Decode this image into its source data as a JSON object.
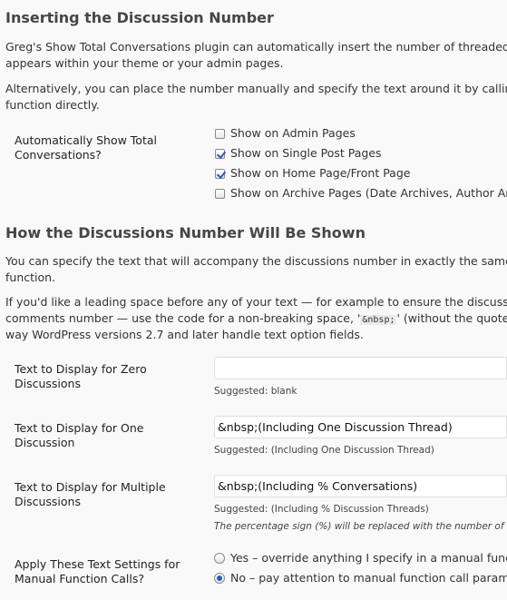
{
  "section1": {
    "heading": "Inserting the Discussion Number",
    "para1_line1": "Greg's Show Total Conversations plugin can automatically insert the number of threaded disc",
    "para1_line2": "appears within your theme or your admin pages.",
    "para2_line1": "Alternatively, you can place the number manually and specify the text around it by calling the",
    "para2_line2": "function directly.",
    "field_label": "Automatically Show Total Conversations?",
    "options": [
      {
        "label": "Show on Admin Pages",
        "checked": false
      },
      {
        "label": "Show on Single Post Pages",
        "checked": true
      },
      {
        "label": "Show on Home Page/Front Page",
        "checked": true
      },
      {
        "label": "Show on Archive Pages (Date Archives, Author Archi",
        "checked": false
      }
    ]
  },
  "section2": {
    "heading": "How the Discussions Number Will Be Shown",
    "para1_line1": "You can specify the text that will accompany the discussions number in exactly the same way",
    "para1_line2": "function.",
    "para2_line1": "If you'd like a leading space before any of your text — for example to ensure the discussions",
    "para2_line2_a": "comments number — use the code for a non-breaking space, '",
    "para2_code": "&nbsp;",
    "para2_line2_b": "' (without the quotes), t",
    "para2_line3": "way WordPress versions 2.7 and later handle text option fields.",
    "fields": [
      {
        "label": "Text to Display for Zero Discussions",
        "value": "",
        "suggested": "Suggested: blank"
      },
      {
        "label": "Text to Display for One Discussion",
        "value": "&nbsp;(Including One Discussion Thread)",
        "suggested": "Suggested: (Including One Discussion Thread)"
      },
      {
        "label": "Text to Display for Multiple Discussions",
        "value": "&nbsp;(Including % Conversations)",
        "suggested": "Suggested: (Including % Discussion Threads)",
        "note": "The percentage sign (%) will be replaced with the number of"
      }
    ],
    "apply_label": "Apply These Text Settings for Manual Function Calls?",
    "apply_options": [
      {
        "label": "Yes – override anything I specify in a manual functio",
        "selected": false
      },
      {
        "label": "No – pay attention to manual function call paramete",
        "selected": true
      }
    ]
  },
  "colors": {
    "background": "#f9f9f9",
    "heading": "#464646",
    "accent": "#2a5db0"
  }
}
